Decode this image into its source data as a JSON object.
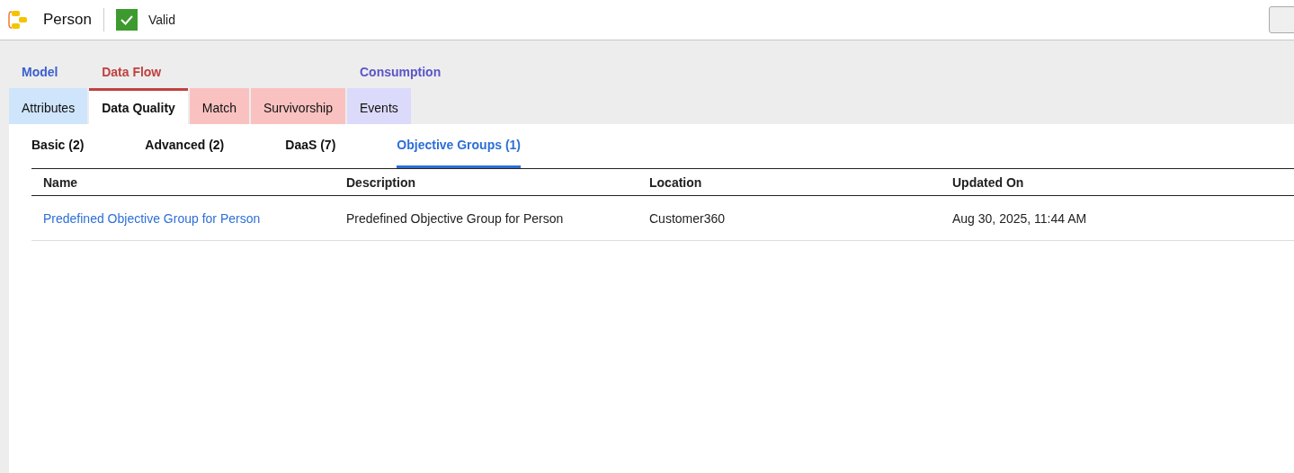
{
  "header": {
    "title": "Person",
    "status": "Valid"
  },
  "tab_groups": [
    {
      "label": "Model",
      "color": "#3b5fd0",
      "tabs": [
        {
          "label": "Attributes",
          "selected": false
        }
      ]
    },
    {
      "label": "Data Flow",
      "color": "#c0413f",
      "tabs": [
        {
          "label": "Data Quality",
          "selected": true
        },
        {
          "label": "Match",
          "selected": false
        },
        {
          "label": "Survivorship",
          "selected": false
        }
      ]
    },
    {
      "label": "Consumption",
      "color": "#5a55c9",
      "tabs": [
        {
          "label": "Events",
          "selected": false
        }
      ]
    }
  ],
  "sub_tabs": [
    {
      "label": "Basic (2)",
      "selected": false
    },
    {
      "label": "Advanced (2)",
      "selected": false
    },
    {
      "label": "DaaS (7)",
      "selected": false
    },
    {
      "label": "Objective Groups (1)",
      "selected": true
    }
  ],
  "table": {
    "columns": [
      "Name",
      "Description",
      "Location",
      "Updated On"
    ],
    "rows": [
      [
        "Predefined Objective Group for Person",
        "Predefined Objective Group for Person",
        "Customer360",
        "Aug 30, 2025, 11:44 AM"
      ]
    ]
  }
}
